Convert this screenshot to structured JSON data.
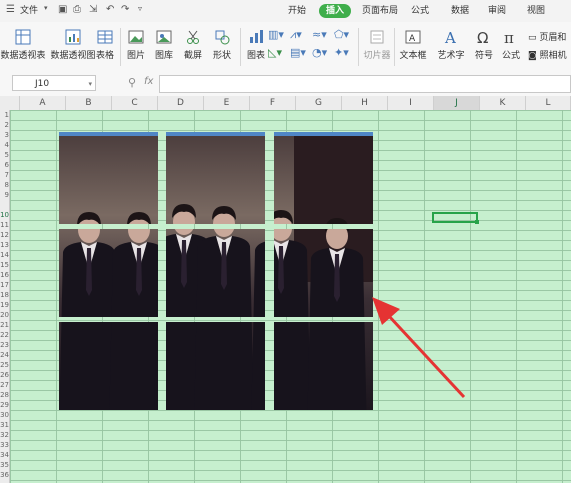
{
  "topbar": {
    "file_label": "文件",
    "tabs": [
      "开始",
      "插入",
      "页面布局",
      "公式",
      "数据",
      "审阅",
      "视图"
    ],
    "active_tab": "插入"
  },
  "ribbon": {
    "pivot_table": "数据透视表",
    "pivot_chart": "数据透视图",
    "table": "表格",
    "picture": "图片",
    "gallery": "图库",
    "screenshot": "截屏",
    "shape": "形状",
    "chart": "图表",
    "slicer": "切片器",
    "textbox": "文本框",
    "wordart": "艺术字",
    "symbol": "符号",
    "formula": "公式",
    "header_footer": "页眉和",
    "camera": "照相机"
  },
  "formula_bar": {
    "name_box": "J10",
    "fx_label": "fx",
    "value": ""
  },
  "sheet": {
    "columns": [
      "A",
      "B",
      "C",
      "D",
      "E",
      "F",
      "G",
      "H",
      "I",
      "J",
      "K",
      "L"
    ],
    "selected_column": "J",
    "rows": [
      "1",
      "2",
      "3",
      "4",
      "5",
      "6",
      "7",
      "8",
      "9",
      "10",
      "11",
      "12",
      "13",
      "14",
      "15",
      "16",
      "17",
      "18",
      "19",
      "20",
      "21",
      "22",
      "23",
      "24",
      "25",
      "26",
      "27",
      "28",
      "29",
      "30",
      "31",
      "32",
      "33",
      "34",
      "35",
      "36"
    ],
    "selected_cell": "J10"
  },
  "colors": {
    "accent": "#3fae4b",
    "grid_fill": "#c6efce",
    "selection": "#27a349",
    "arrow": "#e53333"
  }
}
